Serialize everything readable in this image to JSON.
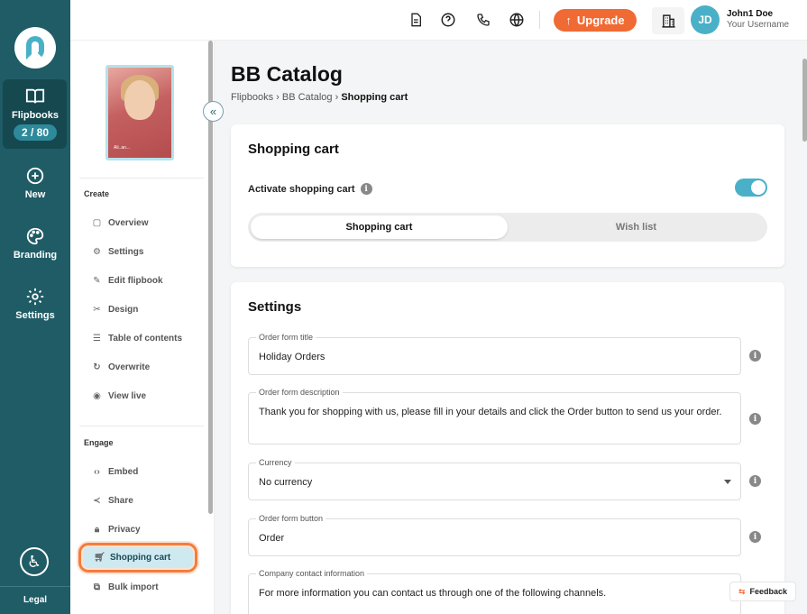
{
  "rail": {
    "items": [
      {
        "label": "Flipbooks",
        "icon": "book-icon"
      },
      {
        "label": "New",
        "icon": "plus-circle-icon"
      },
      {
        "label": "Branding",
        "icon": "palette-icon"
      },
      {
        "label": "Settings",
        "icon": "gear-icon"
      }
    ],
    "counter": "2 / 80",
    "legal": "Legal"
  },
  "topbar": {
    "upgrade_label": "Upgrade",
    "avatar_initials": "JD",
    "user_name": "John1 Doe",
    "user_sub": "Your Username"
  },
  "sidebar": {
    "thumb_text": "Ali..an...",
    "create_title": "Create",
    "create_items": [
      {
        "label": "Overview",
        "icon": "layout-icon"
      },
      {
        "label": "Settings",
        "icon": "gear-icon"
      },
      {
        "label": "Edit flipbook",
        "icon": "pencil-icon"
      },
      {
        "label": "Design",
        "icon": "design-tools-icon"
      },
      {
        "label": "Table of contents",
        "icon": "list-icon"
      },
      {
        "label": "Overwrite",
        "icon": "refresh-icon"
      },
      {
        "label": "View live",
        "icon": "eye-icon"
      }
    ],
    "engage_title": "Engage",
    "engage_items": [
      {
        "label": "Embed",
        "icon": "code-icon"
      },
      {
        "label": "Share",
        "icon": "share-icon"
      },
      {
        "label": "Privacy",
        "icon": "lock-icon"
      },
      {
        "label": "Shopping cart",
        "icon": "cart-icon"
      },
      {
        "label": "Bulk import",
        "icon": "import-icon"
      }
    ]
  },
  "main": {
    "title": "BB Catalog",
    "breadcrumb": [
      "Flipbooks",
      "BB Catalog",
      "Shopping cart"
    ],
    "cart_card": {
      "title": "Shopping cart",
      "activate_label": "Activate shopping cart",
      "activate_on": true,
      "tabs": [
        "Shopping cart",
        "Wish list"
      ]
    },
    "settings_card": {
      "title": "Settings",
      "fields": [
        {
          "label": "Order form title",
          "value": "Holiday Orders"
        },
        {
          "label": "Order form description",
          "value": "Thank you for shopping with us, please fill in your details and click the Order button to send us your order."
        },
        {
          "label": "Currency",
          "value": "No currency"
        },
        {
          "label": "Order form button",
          "value": "Order"
        },
        {
          "label": "Company contact information",
          "value": "For more information you can contact us through one of the following channels."
        }
      ]
    },
    "feedback_label": "Feedback"
  },
  "colors": {
    "rail": "#1f5c66",
    "accent": "#4ab0c8",
    "upgrade": "#f06a34"
  }
}
